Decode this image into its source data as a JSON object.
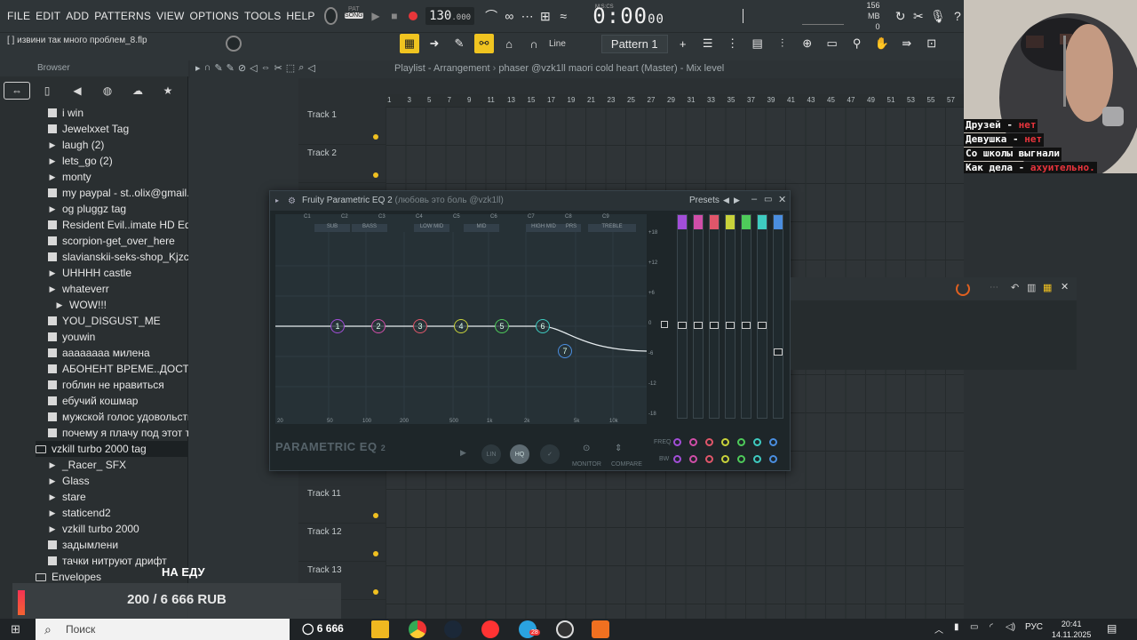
{
  "menu": [
    "FILE",
    "EDIT",
    "ADD",
    "PATTERNS",
    "VIEW",
    "OPTIONS",
    "TOOLS",
    "HELP"
  ],
  "pat_label": "PAT",
  "song_label": "SONG",
  "tempo": "130",
  "tempo_fraction": ".000",
  "time_main": "0:00",
  "time_fraction": "00",
  "time_unit": "M:S:CS",
  "memory": "156 MB",
  "cpu": "0",
  "hint_text": "[ ] извини так много проблем_8.flp",
  "snap_mode": "Line",
  "pattern": "Pattern 1",
  "browser": {
    "title": "Browser",
    "items": [
      {
        "label": "i win",
        "icon": "wav"
      },
      {
        "label": "Jewelxxet Tag",
        "icon": "wav"
      },
      {
        "label": "laugh (2)",
        "icon": "play"
      },
      {
        "label": "lets_go (2)",
        "icon": "play"
      },
      {
        "label": "monty",
        "icon": "play"
      },
      {
        "label": "my paypal - st..olix@gmail.com",
        "icon": "wav"
      },
      {
        "label": "og pluggz tag",
        "icon": "play"
      },
      {
        "label": "Resident Evil..imate HD Edition",
        "icon": "wav"
      },
      {
        "label": "scorpion-get_over_here",
        "icon": "wav"
      },
      {
        "label": "slavianskii-seks-shop_Kjzc1AY",
        "icon": "wav"
      },
      {
        "label": "UHHHH castle",
        "icon": "play"
      },
      {
        "label": "whateverr",
        "icon": "play"
      },
      {
        "label": "WOW!!!",
        "icon": "play"
      },
      {
        "label": "YOU_DISGUST_ME",
        "icon": "wav"
      },
      {
        "label": "youwin",
        "icon": "wav"
      },
      {
        "label": "аааааааа милена",
        "icon": "wav"
      },
      {
        "label": "АБОНЕНТ ВРЕМЕ..ДОСТУПЕН!!!!",
        "icon": "wav"
      },
      {
        "label": "гоблин не нравиться",
        "icon": "wav"
      },
      {
        "label": "ебучий кошмар",
        "icon": "wav"
      },
      {
        "label": "мужской голос удовольствия",
        "icon": "wav"
      },
      {
        "label": "почему я плачу под этот трек",
        "icon": "wav"
      },
      {
        "label": "vzkill turbo 2000 tag",
        "icon": "folder"
      },
      {
        "label": "_Racer_ SFX",
        "icon": "play"
      },
      {
        "label": "Glass",
        "icon": "play"
      },
      {
        "label": "stare",
        "icon": "play"
      },
      {
        "label": "staticend2",
        "icon": "play"
      },
      {
        "label": "vzkill turbo 2000",
        "icon": "play"
      },
      {
        "label": "задымлени",
        "icon": "wav"
      },
      {
        "label": "тачки нитруют дрифт",
        "icon": "wav"
      },
      {
        "label": "Envelopes",
        "icon": "folder"
      }
    ]
  },
  "playlist": {
    "title": "Playlist - Arrangement",
    "crumb": "phaser @vzk1ll maori cold heart (Master) - Mix level",
    "ruler": [
      "1",
      "3",
      "5",
      "7",
      "9",
      "11",
      "13",
      "15",
      "17",
      "19",
      "21",
      "23",
      "25",
      "27",
      "29",
      "31",
      "33",
      "35",
      "37",
      "39",
      "41",
      "43",
      "45",
      "47",
      "49",
      "51",
      "53",
      "55",
      "57"
    ],
    "tracks": [
      {
        "name": "Track 1",
        "visible": true
      },
      {
        "name": "Track 2",
        "visible": true
      },
      {
        "name": "Track 11",
        "visible": true
      },
      {
        "name": "Track 12",
        "visible": true
      },
      {
        "name": "Track 13",
        "visible": true
      }
    ]
  },
  "eq": {
    "title": "Fruity Parametric EQ 2",
    "subtitle": "(любовь это боль @vzk1ll)",
    "presets": "Presets",
    "bands": [
      "C1",
      "C2",
      "C3",
      "C4",
      "C5",
      "C6",
      "C7",
      "C8",
      "C9"
    ],
    "band_names": [
      "SUB",
      "BASS",
      "LOW MID",
      "MID",
      "HIGH MID",
      "PRS",
      "TREBLE"
    ],
    "freq_labels": [
      "20",
      "50",
      "100",
      "200",
      "500",
      "1k",
      "2k",
      "5k",
      "10k"
    ],
    "db_labels": [
      "+18",
      "+12",
      "+6",
      "0",
      "-6",
      "-12",
      "-18"
    ],
    "brand": "PARAMETRIC EQ",
    "brand_num": "2",
    "lin_label": "LIN",
    "hq_label": "HQ",
    "monitor": "MONITOR",
    "compare": "COMPARE",
    "freq_label": "FREQ",
    "bw_label": "BW",
    "band_colors": [
      "#a24ed8",
      "#d04ea8",
      "#e0566a",
      "#c8d23a",
      "#4ecb5a",
      "#3ecbc0",
      "#4a8ee0"
    ]
  },
  "webcam": {
    "lines": [
      {
        "text": "Друзей - ",
        "red": "нет"
      },
      {
        "text": "Девушка - ",
        "red": "нет"
      },
      {
        "text": "Со школы выгнали",
        "red": ""
      },
      {
        "text": "Как дела - ",
        "red": "ахуительно."
      }
    ]
  },
  "donation": {
    "title": "НА ЕДУ",
    "amount": "200 / 6 666 RUB"
  },
  "taskbar": {
    "search": "Поиск",
    "counter": "6 666",
    "lang": "РУС",
    "time": "20:41",
    "date": "14.11.2025",
    "badge": "28"
  }
}
